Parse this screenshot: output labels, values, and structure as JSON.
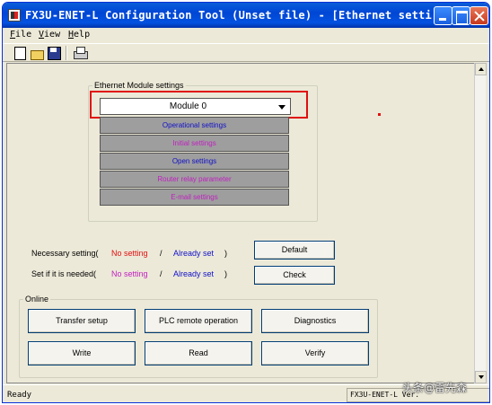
{
  "window": {
    "title": "FX3U-ENET-L Configuration Tool (Unset file) - [Ethernet setti...",
    "buttons": {
      "minimize": "minimize",
      "maximize": "maximize",
      "close": "close"
    }
  },
  "menu": {
    "items": [
      "File",
      "View",
      "Help"
    ]
  },
  "toolbar": {
    "icons": [
      "new-icon",
      "open-icon",
      "save-icon",
      "print-icon"
    ]
  },
  "ethernet": {
    "group_label": "Ethernet Module settings",
    "module_select": "Module 0",
    "buttons": [
      "Operational settings",
      "Initial settings",
      "Open settings",
      "Router relay parameter",
      "E-mail settings"
    ]
  },
  "legend": {
    "necessary_label": "Necessary setting(",
    "needed_label": "Set if it is needed(",
    "no_setting": "No setting",
    "slash": "/",
    "already_set": "Already set",
    "close_paren": ")"
  },
  "actions": {
    "default": "Default",
    "check": "Check"
  },
  "online": {
    "label": "Online",
    "transfer_setup": "Transfer setup",
    "plc_remote": "PLC remote operation",
    "diagnostics": "Diagnostics",
    "write": "Write",
    "read": "Read",
    "verify": "Verify"
  },
  "status": {
    "text": "Ready",
    "panel": "FX3U-ENET-L Ver.",
    "watermark": "头条@雷先森"
  },
  "colors": {
    "no_setting_necessary": "#e01010",
    "no_setting_needed": "#c020c0",
    "already_set": "#1010c8",
    "highlight": "#e01010"
  }
}
